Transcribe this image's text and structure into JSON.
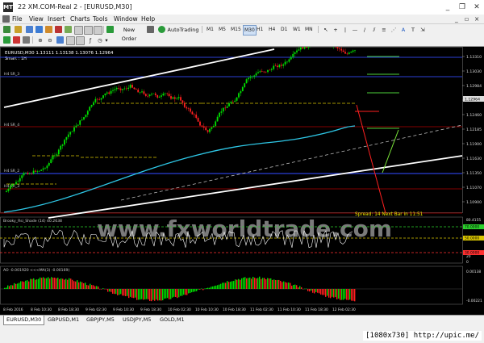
{
  "window": {
    "app_icon": "MT",
    "title": "22            XM.COM-Real 2 - [EURUSD,M30]",
    "minimize": "_",
    "restore": "❐",
    "close": "✕"
  },
  "menu": [
    "File",
    "View",
    "Insert",
    "Charts",
    "Tools",
    "Window",
    "Help"
  ],
  "toolbar": {
    "new_order": "New Order",
    "autotrading": "AutoTrading",
    "timeframes": [
      "M1",
      "M5",
      "M15",
      "M30",
      "H1",
      "H4",
      "D1",
      "W1",
      "MN"
    ]
  },
  "chart": {
    "header": "EURUSD,M30  1.13111 1.13138 1.13076 1.12964",
    "smart_label": "Smart : 1H",
    "levels": [
      {
        "label": "H4 SR_3"
      },
      {
        "label": "H4 SR_4"
      },
      {
        "label": "H4 SR_2"
      },
      {
        "label": "H4 SR_3"
      }
    ],
    "price_axis": [
      "1.13310",
      "1.13030",
      "1.12984",
      "1.12740",
      "1.12460",
      "1.12185",
      "1.11900",
      "1.11630",
      "1.11350",
      "1.11070",
      "1.10900"
    ],
    "current_price": "1.12964",
    "spread_text": "Spread: 14  Next Bar in 11:51",
    "watermark_text": "www.fxworldtrade.com",
    "brooky_label": "Brooky_Rsi_Shade (14) 40.2638",
    "rsi_axis": [
      "80.4155",
      "70.0000",
      "50.0000",
      "30.0000",
      "20",
      "0"
    ],
    "rsi_badges": [
      "70.0000",
      "50.0000",
      "30.0000"
    ],
    "ao_label": "AO -0.001920 <<<MA(3) -0.00169)",
    "ao_axis": [
      "0.00138",
      "-0.00221"
    ],
    "time_axis": [
      "8 Feb 2016",
      "8 Feb 10:30",
      "8 Feb 18:30",
      "9 Feb 02:30",
      "9 Feb 10:30",
      "9 Feb 18:30",
      "10 Feb 02:30",
      "10 Feb 10:30",
      "10 Feb 18:30",
      "11 Feb 02:30",
      "11 Feb 10:30",
      "11 Feb 18:30",
      "12 Feb 02:30"
    ],
    "colors": {
      "background": "#000000",
      "bull": "#00e000",
      "bear": "#ff2020",
      "channel": "#ffffff",
      "ma": "#2ec7e6",
      "level_blue": "#2b3fd6",
      "level_red": "#b00000",
      "spread_text": "#e6e600",
      "watermark": "#7a7a7a"
    }
  },
  "tabs": [
    "EURUSD,M30",
    "GBPUSD,M1",
    "GBPJPY,M5",
    "USDJPY,M5",
    "GOLD,M1"
  ],
  "watermark_label": "[1080x730] http://upic.me/"
}
